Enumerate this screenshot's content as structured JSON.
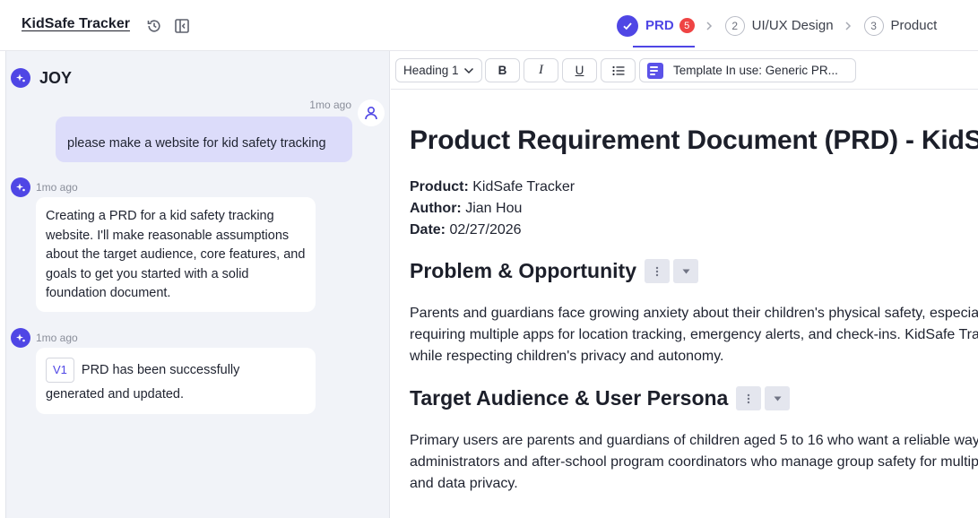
{
  "app": {
    "title": "KidSafe Tracker"
  },
  "steps": [
    {
      "num": "",
      "label": "PRD",
      "badge": "5",
      "active": true
    },
    {
      "num": "2",
      "label": "UI/UX Design"
    },
    {
      "num": "3",
      "label": "Product"
    }
  ],
  "chat": {
    "assistant_name": "JOY",
    "user_message": {
      "time": "1mo ago",
      "text": "please make a website for kid safety tracking"
    },
    "bot_messages": [
      {
        "time": "1mo ago",
        "text": "Creating a PRD for a kid safety tracking website. I'll make reasonable assumptions about the target audience, core features, and goals to get you started with a solid foundation document."
      },
      {
        "time": "1mo ago",
        "version": "V1",
        "text_line1": "PRD has been successfully",
        "text_line2": "generated and updated."
      }
    ]
  },
  "toolbar": {
    "heading_select": "Heading 1",
    "bold": "B",
    "italic": "I",
    "underline": "U",
    "template": "Template In use: Generic PR..."
  },
  "document": {
    "title": "Product Requirement Document (PRD) - KidSafe Tracker",
    "product_label": "Product:",
    "product": "KidSafe Tracker",
    "author_label": "Author:",
    "author": "Jian Hou",
    "date_label": "Date:",
    "date": "02/27/2026",
    "sections": [
      {
        "heading": "Problem & Opportunity",
        "lines": [
          "Parents and guardians face growing anxiety about their children's physical safety, especially",
          "requiring multiple apps for location tracking, emergency alerts, and check-ins. KidSafe Tracker",
          "while respecting children's privacy and autonomy."
        ]
      },
      {
        "heading": "Target Audience & User Persona",
        "lines": [
          "Primary users are parents and guardians of children aged 5 to 16 who want a reliable way to",
          "administrators and after-school program coordinators who manage group safety for multiple",
          "and data privacy."
        ]
      }
    ]
  },
  "colors": {
    "accent": "#4f46e5",
    "badge": "#ef4444",
    "chat_bg": "#f1f3f8",
    "user_bubble": "#dcdcfa"
  },
  "icons": [
    "history-icon",
    "collapse-panel-icon",
    "check-icon",
    "chevron-right-icon",
    "bot-sparkle-icon",
    "user-icon",
    "chevron-down-icon",
    "bullet-list-icon",
    "template-doc-icon",
    "more-vertical-icon",
    "caret-down-icon"
  ]
}
